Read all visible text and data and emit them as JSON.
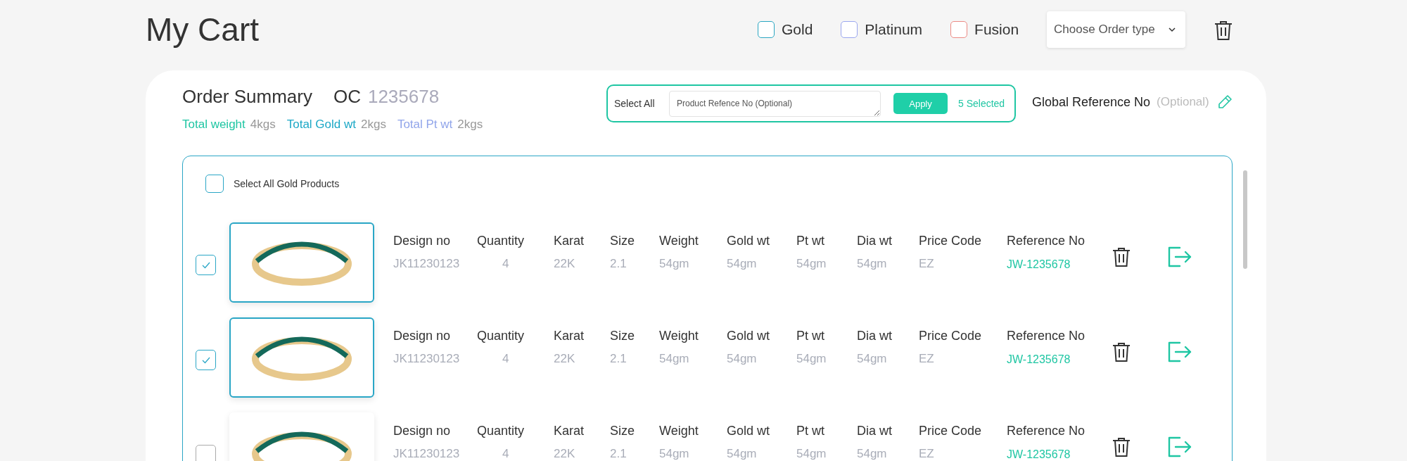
{
  "page": {
    "title": "My Cart"
  },
  "filters": [
    {
      "label": "Gold",
      "checked": false,
      "color": "#2ba6c2"
    },
    {
      "label": "Platinum",
      "checked": false,
      "color": "#9aa6ef"
    },
    {
      "label": "Fusion",
      "checked": false,
      "color": "#ec8a84"
    }
  ],
  "order_type": {
    "placeholder": "Choose Order type"
  },
  "summary": {
    "title": "Order Summary",
    "oc_label": "OC",
    "oc_number": "1235678",
    "totals": [
      {
        "label": "Total weight",
        "value": "4kgs",
        "color": "#1fc6a3"
      },
      {
        "label": "Total Gold wt",
        "value": "2kgs",
        "color": "#1ca8c6"
      },
      {
        "label": "Total Pt wt",
        "value": "2kgs",
        "color": "#91a5ea"
      }
    ]
  },
  "bulk": {
    "select_all": "Select All",
    "placeholder": "Product Refence No (Optional)",
    "apply": "Apply",
    "selected_count": "5 Selected"
  },
  "global_reference": {
    "label": "Global Reference No",
    "hint": "(Optional)"
  },
  "group": {
    "select_all_label": "Select All Gold Products",
    "checked": false
  },
  "rows": [
    {
      "selected": true,
      "cells": [
        {
          "label": "Design no",
          "value": "JK11230123",
          "kind": "text"
        },
        {
          "label": "Quantity",
          "value": "4",
          "kind": "count"
        },
        {
          "label": "Karat",
          "value": "22K",
          "kind": "text"
        },
        {
          "label": "Size",
          "value": "2.1",
          "kind": "text"
        },
        {
          "label": "Weight",
          "value": "54gm",
          "kind": "text"
        },
        {
          "label": "Gold wt",
          "value": "54gm",
          "kind": "text"
        },
        {
          "label": "Pt wt",
          "value": "54gm",
          "kind": "text"
        },
        {
          "label": "Dia wt",
          "value": "54gm",
          "kind": "text"
        },
        {
          "label": "Price Code",
          "value": "EZ",
          "kind": "text"
        },
        {
          "label": "Reference No",
          "value": "JW-1235678",
          "kind": "reference"
        }
      ]
    },
    {
      "selected": true,
      "cells": [
        {
          "label": "Design no",
          "value": "JK11230123",
          "kind": "text"
        },
        {
          "label": "Quantity",
          "value": "4",
          "kind": "count"
        },
        {
          "label": "Karat",
          "value": "22K",
          "kind": "text"
        },
        {
          "label": "Size",
          "value": "2.1",
          "kind": "text"
        },
        {
          "label": "Weight",
          "value": "54gm",
          "kind": "text"
        },
        {
          "label": "Gold wt",
          "value": "54gm",
          "kind": "text"
        },
        {
          "label": "Pt wt",
          "value": "54gm",
          "kind": "text"
        },
        {
          "label": "Dia wt",
          "value": "54gm",
          "kind": "text"
        },
        {
          "label": "Price Code",
          "value": "EZ",
          "kind": "text"
        },
        {
          "label": "Reference No",
          "value": "JW-1235678",
          "kind": "reference"
        }
      ]
    },
    {
      "selected": false,
      "cells": [
        {
          "label": "Design no",
          "value": "JK11230123",
          "kind": "text"
        },
        {
          "label": "Quantity",
          "value": "4",
          "kind": "count"
        },
        {
          "label": "Karat",
          "value": "22K",
          "kind": "text"
        },
        {
          "label": "Size",
          "value": "2.1",
          "kind": "text"
        },
        {
          "label": "Weight",
          "value": "54gm",
          "kind": "text"
        },
        {
          "label": "Gold wt",
          "value": "54gm",
          "kind": "text"
        },
        {
          "label": "Pt wt",
          "value": "54gm",
          "kind": "text"
        },
        {
          "label": "Dia wt",
          "value": "54gm",
          "kind": "text"
        },
        {
          "label": "Price Code",
          "value": "EZ",
          "kind": "text"
        },
        {
          "label": "Reference No",
          "value": "JW-1235678",
          "kind": "reference"
        }
      ]
    }
  ]
}
